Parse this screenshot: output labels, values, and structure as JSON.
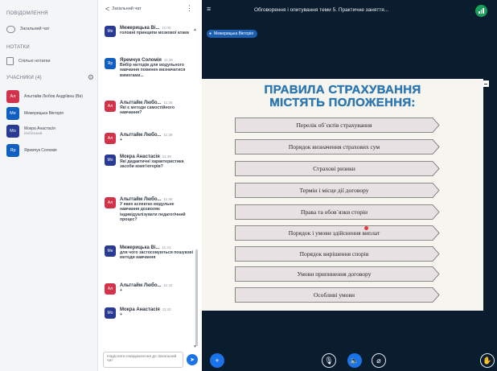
{
  "sidebar": {
    "notifications_title": "ПОВІДОМЛЕННЯ",
    "public_chat": "Загальний чат",
    "notes_title": "НОТАТКИ",
    "shared_notes": "Спільні нотатки",
    "users_title": "УЧАСНИКИ (4)",
    "users": [
      {
        "initials": "Ал",
        "name": "Альтгайм Любов Андріївна (Ви)",
        "sub": "",
        "color": "#d1344a"
      },
      {
        "initials": "Ме",
        "name": "Межерицька Вікторія",
        "sub": "",
        "color": "#0f5ec0"
      },
      {
        "initials": "Мо",
        "name": "Мокра Анастасія",
        "sub": "Мобільний",
        "color": "#283a92"
      },
      {
        "initials": "Яр",
        "name": "Яремчук Соломія",
        "sub": "",
        "color": "#0f5ec0"
      }
    ]
  },
  "chat": {
    "back_label": "<",
    "title": "Загальний чат",
    "more_icon": "⋮",
    "compose_placeholder": "Надіслати повідомлення до Загальний чат",
    "messages": [
      {
        "initials": "",
        "who": "",
        "time": "",
        "text": "",
        "color": "#283a92"
      },
      {
        "initials": "Ме",
        "who": "Межерицька Ві...",
        "time": "11:05",
        "text": "головні принципи мозкової атаки",
        "color": "#283a92"
      },
      {
        "initials": "Яр",
        "who": "Яремчук Соломія",
        "time": "11:35",
        "text": "Вибір методів для модульного навчання повинен визначатися вимогами...",
        "color": "#0f5ec0"
      },
      {
        "initials": "Ал",
        "who": "Альтгайм Любо...",
        "time": "11:35",
        "text": "Які є методи самостійного навчання?",
        "color": "#d1344a"
      },
      {
        "initials": "Ал",
        "who": "Альтгайм Любо...",
        "time": "11:38",
        "text": "+",
        "color": "#d1344a"
      },
      {
        "initials": "Мо",
        "who": "Мокра Анастасія",
        "time": "11:39",
        "text": "Які дидактичні характеристика засоби комп'ютерів?",
        "color": "#283a92"
      },
      {
        "initials": "Ал",
        "who": "Альтгайм Любо...",
        "time": "11:40",
        "text": "У яких аспектах модульне навчання дозволяє індивідуалізувати педагогічний процес?",
        "color": "#d1344a"
      },
      {
        "initials": "Ме",
        "who": "Межерицька Ві...",
        "time": "11:41",
        "text": "для чого застосовуються пошукові методи навчання",
        "color": "#283a92"
      },
      {
        "initials": "Ал",
        "who": "Альтгайм Любо...",
        "time": "11:42",
        "text": "+",
        "color": "#d1344a"
      },
      {
        "initials": "Мо",
        "who": "Мокра Анастасія",
        "time": "11:42",
        "text": "+",
        "color": "#283a92"
      }
    ]
  },
  "main": {
    "menu_icon": "hamburger-icon",
    "title": "Обговорення і опитування теми 5. Практичне заняття...",
    "presenter": "Межерицька Вікторія",
    "slide": {
      "title_line1": "ПРАВИЛА СТРАХУВАННЯ",
      "title_line2": "МІСТЯТЬ ПОЛОЖЕННЯ:",
      "items": [
        "Перелік об`єктів страхування",
        "Порядок визначення страхових  сум",
        "Страхові ризики",
        "Термін і місце дії договору",
        "Права та обов`язки сторін",
        "Порядок і умови здійснення виплат",
        "Порядок вирішення спорів",
        "Умови припинення договору",
        "Особливі умови"
      ]
    }
  },
  "colors": {
    "accent": "#1a73e8",
    "main_bg": "#0a1d2f",
    "slide_title": "#2a7ab8",
    "arrow_fill": "#e7e1e4",
    "status_ok": "#18a05a"
  }
}
